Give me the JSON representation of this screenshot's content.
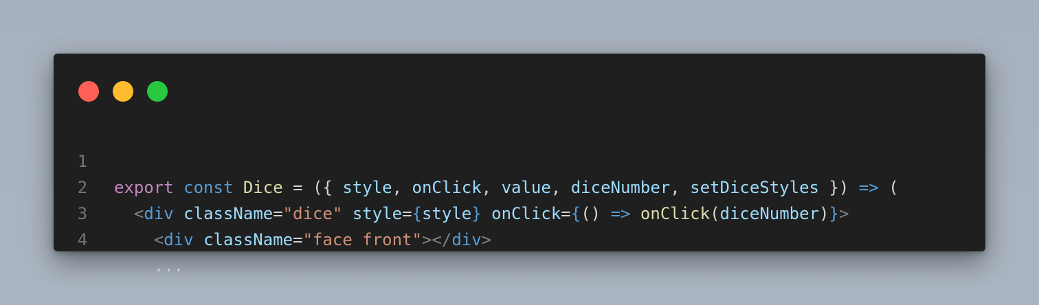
{
  "window": {
    "traffic_lights": [
      {
        "name": "close",
        "color": "#ff5f57"
      },
      {
        "name": "minimize",
        "color": "#febc2e"
      },
      {
        "name": "maximize",
        "color": "#28c840"
      }
    ]
  },
  "colors": {
    "keyword_purple": "#c586c0",
    "keyword_blue": "#569cd6",
    "identifier": "#9cdcfe",
    "function": "#dcdcaa",
    "string": "#ce9178",
    "tag": "#569cd6",
    "punctuation": "#d4d4d4",
    "bracket_tag": "#808080",
    "line_number": "#6e7681",
    "background": "#1f1f1f"
  },
  "code": {
    "lines": [
      {
        "number": "1",
        "tokens": [
          {
            "t": "export",
            "c": "#c586c0"
          },
          {
            "t": " ",
            "c": "#d4d4d4"
          },
          {
            "t": "const",
            "c": "#569cd6"
          },
          {
            "t": " ",
            "c": "#d4d4d4"
          },
          {
            "t": "Dice",
            "c": "#dcdcaa"
          },
          {
            "t": " = ({ ",
            "c": "#d4d4d4"
          },
          {
            "t": "style",
            "c": "#9cdcfe"
          },
          {
            "t": ", ",
            "c": "#d4d4d4"
          },
          {
            "t": "onClick",
            "c": "#9cdcfe"
          },
          {
            "t": ", ",
            "c": "#d4d4d4"
          },
          {
            "t": "value",
            "c": "#9cdcfe"
          },
          {
            "t": ", ",
            "c": "#d4d4d4"
          },
          {
            "t": "diceNumber",
            "c": "#9cdcfe"
          },
          {
            "t": ", ",
            "c": "#d4d4d4"
          },
          {
            "t": "setDiceStyles",
            "c": "#9cdcfe"
          },
          {
            "t": " }) ",
            "c": "#d4d4d4"
          },
          {
            "t": "=>",
            "c": "#569cd6"
          },
          {
            "t": " (",
            "c": "#d4d4d4"
          }
        ]
      },
      {
        "number": "2",
        "tokens": [
          {
            "t": "  ",
            "c": "#d4d4d4"
          },
          {
            "t": "<",
            "c": "#808080"
          },
          {
            "t": "div",
            "c": "#569cd6"
          },
          {
            "t": " ",
            "c": "#d4d4d4"
          },
          {
            "t": "className",
            "c": "#9cdcfe"
          },
          {
            "t": "=",
            "c": "#d4d4d4"
          },
          {
            "t": "\"dice\"",
            "c": "#ce9178"
          },
          {
            "t": " ",
            "c": "#d4d4d4"
          },
          {
            "t": "style",
            "c": "#9cdcfe"
          },
          {
            "t": "=",
            "c": "#d4d4d4"
          },
          {
            "t": "{",
            "c": "#569cd6"
          },
          {
            "t": "style",
            "c": "#9cdcfe"
          },
          {
            "t": "}",
            "c": "#569cd6"
          },
          {
            "t": " ",
            "c": "#d4d4d4"
          },
          {
            "t": "onClick",
            "c": "#9cdcfe"
          },
          {
            "t": "=",
            "c": "#d4d4d4"
          },
          {
            "t": "{",
            "c": "#569cd6"
          },
          {
            "t": "() ",
            "c": "#d4d4d4"
          },
          {
            "t": "=>",
            "c": "#569cd6"
          },
          {
            "t": " ",
            "c": "#d4d4d4"
          },
          {
            "t": "onClick",
            "c": "#dcdcaa"
          },
          {
            "t": "(",
            "c": "#d4d4d4"
          },
          {
            "t": "diceNumber",
            "c": "#9cdcfe"
          },
          {
            "t": ")",
            "c": "#d4d4d4"
          },
          {
            "t": "}",
            "c": "#569cd6"
          },
          {
            "t": ">",
            "c": "#808080"
          }
        ]
      },
      {
        "number": "3",
        "tokens": [
          {
            "t": "    ",
            "c": "#d4d4d4"
          },
          {
            "t": "<",
            "c": "#808080"
          },
          {
            "t": "div",
            "c": "#569cd6"
          },
          {
            "t": " ",
            "c": "#d4d4d4"
          },
          {
            "t": "className",
            "c": "#9cdcfe"
          },
          {
            "t": "=",
            "c": "#d4d4d4"
          },
          {
            "t": "\"face front\"",
            "c": "#ce9178"
          },
          {
            "t": "></",
            "c": "#808080"
          },
          {
            "t": "div",
            "c": "#569cd6"
          },
          {
            "t": ">",
            "c": "#808080"
          }
        ]
      },
      {
        "number": "4",
        "tokens": [
          {
            "t": "    ...",
            "c": "#d4d4d4"
          }
        ]
      }
    ]
  }
}
